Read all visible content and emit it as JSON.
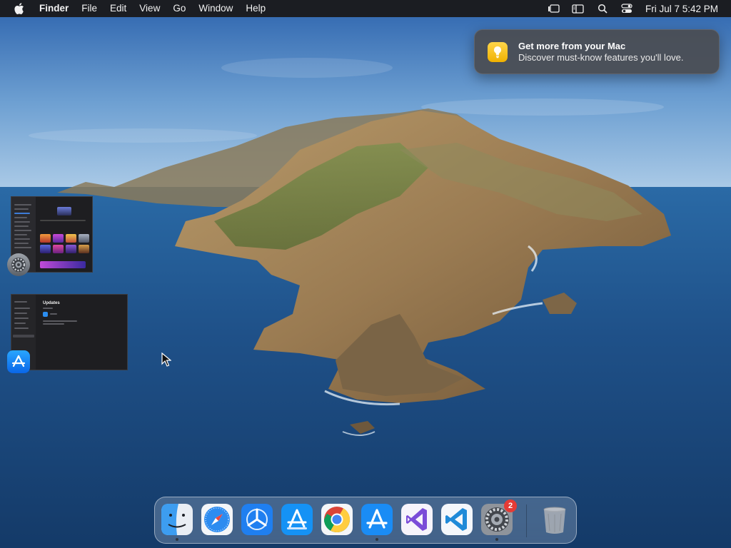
{
  "menubar": {
    "app_name": "Finder",
    "menus": [
      "File",
      "Edit",
      "View",
      "Go",
      "Window",
      "Help"
    ],
    "clock": "Fri Jul 7  5:42 PM",
    "status_icons": [
      "stage-manager-icon",
      "sidebar-display-icon",
      "spotlight-search-icon",
      "control-center-icon"
    ]
  },
  "notification": {
    "title": "Get more from your Mac",
    "body": "Discover must-know features you'll love.",
    "icon": "tips-lightbulb-icon"
  },
  "minimized_windows": [
    {
      "app": "System Settings",
      "icon": "system-settings-gear-icon"
    },
    {
      "app": "App Store",
      "icon": "app-store-icon",
      "thumbnail_title": "Updates"
    }
  ],
  "dock": {
    "apps": [
      {
        "name": "Finder",
        "icon": "finder-icon",
        "running": true
      },
      {
        "name": "Safari",
        "icon": "safari-icon",
        "running": false
      },
      {
        "name": "TestFlight",
        "icon": "testflight-icon",
        "running": false
      },
      {
        "name": "Xcode Instruments",
        "icon": "app-store-blue-icon",
        "running": false
      },
      {
        "name": "Google Chrome",
        "icon": "chrome-icon",
        "running": false
      },
      {
        "name": "App Store",
        "icon": "app-store-icon",
        "running": true
      },
      {
        "name": "Visual Studio",
        "icon": "visual-studio-icon",
        "running": false
      },
      {
        "name": "Visual Studio Code",
        "icon": "vscode-icon",
        "running": false
      },
      {
        "name": "System Settings",
        "icon": "system-settings-icon",
        "running": true,
        "badge": "2"
      }
    ],
    "trash": {
      "name": "Trash",
      "icon": "trash-icon"
    }
  },
  "colors": {
    "menubar_bg": "#1b1d22",
    "badge_red": "#e53b35",
    "sky_top": "#2f6bb8",
    "sea": "#1f4f86"
  }
}
